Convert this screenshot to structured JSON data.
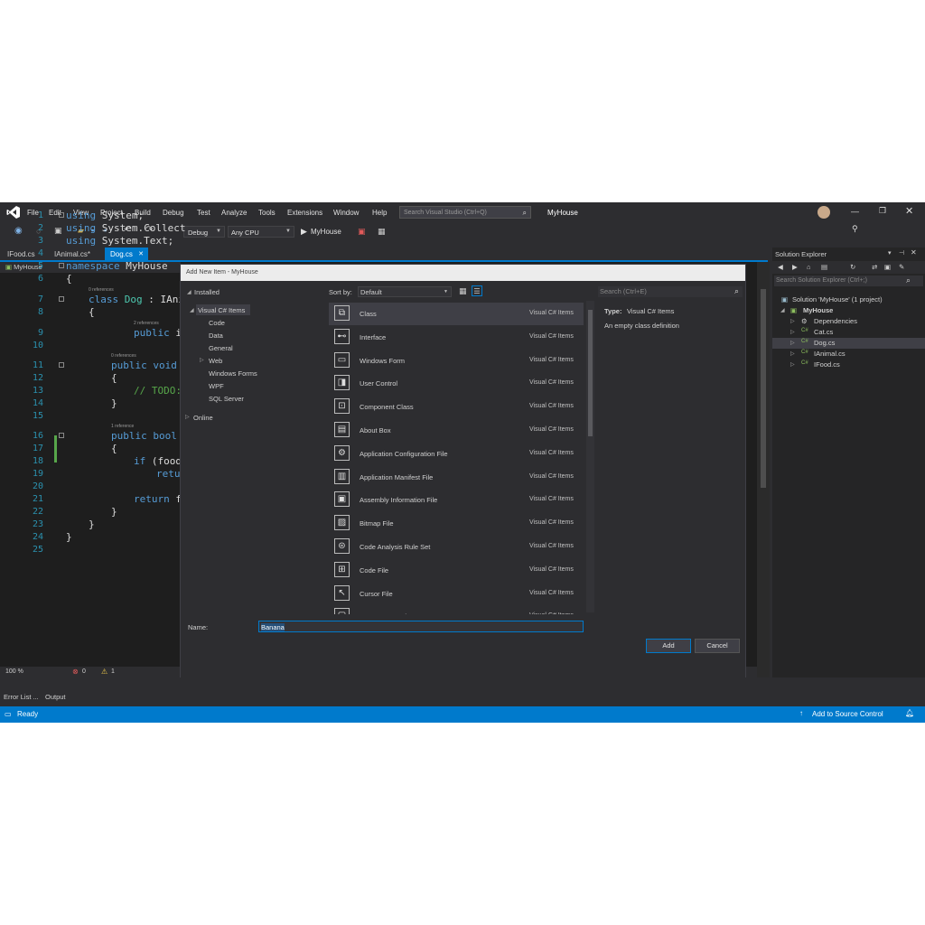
{
  "menu": {
    "items": [
      "File",
      "Edit",
      "View",
      "Project",
      "Build",
      "Debug",
      "Test",
      "Analyze",
      "Tools",
      "Extensions",
      "Window",
      "Help"
    ],
    "search_placeholder": "Search Visual Studio (Ctrl+Q)",
    "solution_title": "MyHouse"
  },
  "toolbar": {
    "configuration": "Debug",
    "platform": "Any CPU",
    "start_target": "MyHouse"
  },
  "tabs": [
    {
      "label": "IFood.cs"
    },
    {
      "label": "IAnimal.cs*"
    },
    {
      "label": "Dog.cs",
      "active": true
    }
  ],
  "editor": {
    "nav_project": "MyHouse",
    "line_numbers": [
      "1",
      "2",
      "3",
      "4",
      "5",
      "6",
      "7",
      "8",
      "9",
      "10",
      "11",
      "12",
      "13",
      "14",
      "15",
      "16",
      "17",
      "18",
      "19",
      "20",
      "21",
      "22",
      "23",
      "24",
      "25"
    ],
    "code": {
      "l1_kw": "using",
      "l1_rest": " System;",
      "l2_kw": "using",
      "l2_rest": " System.Collect",
      "l3_kw": "using",
      "l3_rest": " System.Text;",
      "l5_kw": "namespace",
      "l5_rest": " MyHouse",
      "l6": "{",
      "l7_kw": "class",
      "l7_type": " Dog",
      "l7_rest": " : IAni",
      "l8": "{",
      "l9_kw": "public",
      "l9_rest": " i",
      "l11_kw": "public",
      "l11_kw2": " void",
      "l12": "{",
      "l13": "// TODO:",
      "l14": "}",
      "l16_kw": "public",
      "l16_kw2": " bool",
      "l17": "{",
      "l18_kw": "if",
      "l18_rest": " (food",
      "l19": "retu",
      "l21_kw": "return",
      "l21_rest": " f",
      "l22": "}",
      "l23": "}",
      "l24": "}"
    },
    "refs": {
      "r7": "0 references",
      "r9": "2 references",
      "r11": "0 references",
      "r16": "1 reference"
    },
    "zoom": "100 %",
    "errors": "0",
    "warnings": "1"
  },
  "dialog": {
    "title": "Add New Item - MyHouse",
    "installed_label": "Installed",
    "sort_label": "Sort by:",
    "sort_value": "Default",
    "search_placeholder": "Search (Ctrl+E)",
    "tree": [
      "Visual C# Items",
      "Code",
      "Data",
      "General",
      "Web",
      "Windows Forms",
      "WPF",
      "SQL Server"
    ],
    "online_label": "Online",
    "templates": [
      {
        "name": "Class",
        "lang": "Visual C# Items",
        "icon": "class-icon"
      },
      {
        "name": "Interface",
        "lang": "Visual C# Items",
        "icon": "interface-icon"
      },
      {
        "name": "Windows Form",
        "lang": "Visual C# Items",
        "icon": "windows-form-icon"
      },
      {
        "name": "User Control",
        "lang": "Visual C# Items",
        "icon": "user-control-icon"
      },
      {
        "name": "Component Class",
        "lang": "Visual C# Items",
        "icon": "component-class-icon"
      },
      {
        "name": "About Box",
        "lang": "Visual C# Items",
        "icon": "about-box-icon"
      },
      {
        "name": "Application Configuration File",
        "lang": "Visual C# Items",
        "icon": "config-file-icon"
      },
      {
        "name": "Application Manifest File",
        "lang": "Visual C# Items",
        "icon": "manifest-file-icon"
      },
      {
        "name": "Assembly Information File",
        "lang": "Visual C# Items",
        "icon": "assembly-info-icon"
      },
      {
        "name": "Bitmap File",
        "lang": "Visual C# Items",
        "icon": "bitmap-file-icon"
      },
      {
        "name": "Code Analysis Rule Set",
        "lang": "Visual C# Items",
        "icon": "rule-set-icon"
      },
      {
        "name": "Code File",
        "lang": "Visual C# Items",
        "icon": "code-file-icon"
      },
      {
        "name": "Cursor File",
        "lang": "Visual C# Items",
        "icon": "cursor-file-icon"
      },
      {
        "name": "Custom Control",
        "lang": "Visual C# Items",
        "icon": "custom-control-icon"
      }
    ],
    "detail_type_label": "Type:",
    "detail_type_value": "Visual C# Items",
    "detail_description": "An empty class definition",
    "name_label": "Name:",
    "name_value": "Banana",
    "add_label": "Add",
    "cancel_label": "Cancel"
  },
  "solution_explorer": {
    "title": "Solution Explorer",
    "search_placeholder": "Search Solution Explorer (Ctrl+;)",
    "solution": "Solution 'MyHouse' (1 project)",
    "project": "MyHouse",
    "items": [
      "Dependencies",
      "Cat.cs",
      "Dog.cs",
      "IAnimal.cs",
      "IFood.cs"
    ]
  },
  "bottom_tabs": [
    "Error List ...",
    "Output"
  ],
  "status": {
    "ready": "Ready",
    "source_control": "Add to Source Control"
  },
  "colors": {
    "accent": "#007acc",
    "background": "#2d2d30",
    "editor": "#1e1e1e",
    "keyword": "#569cd6",
    "type": "#4ec9b0",
    "comment": "#57a64a",
    "line_number": "#2b91af"
  }
}
